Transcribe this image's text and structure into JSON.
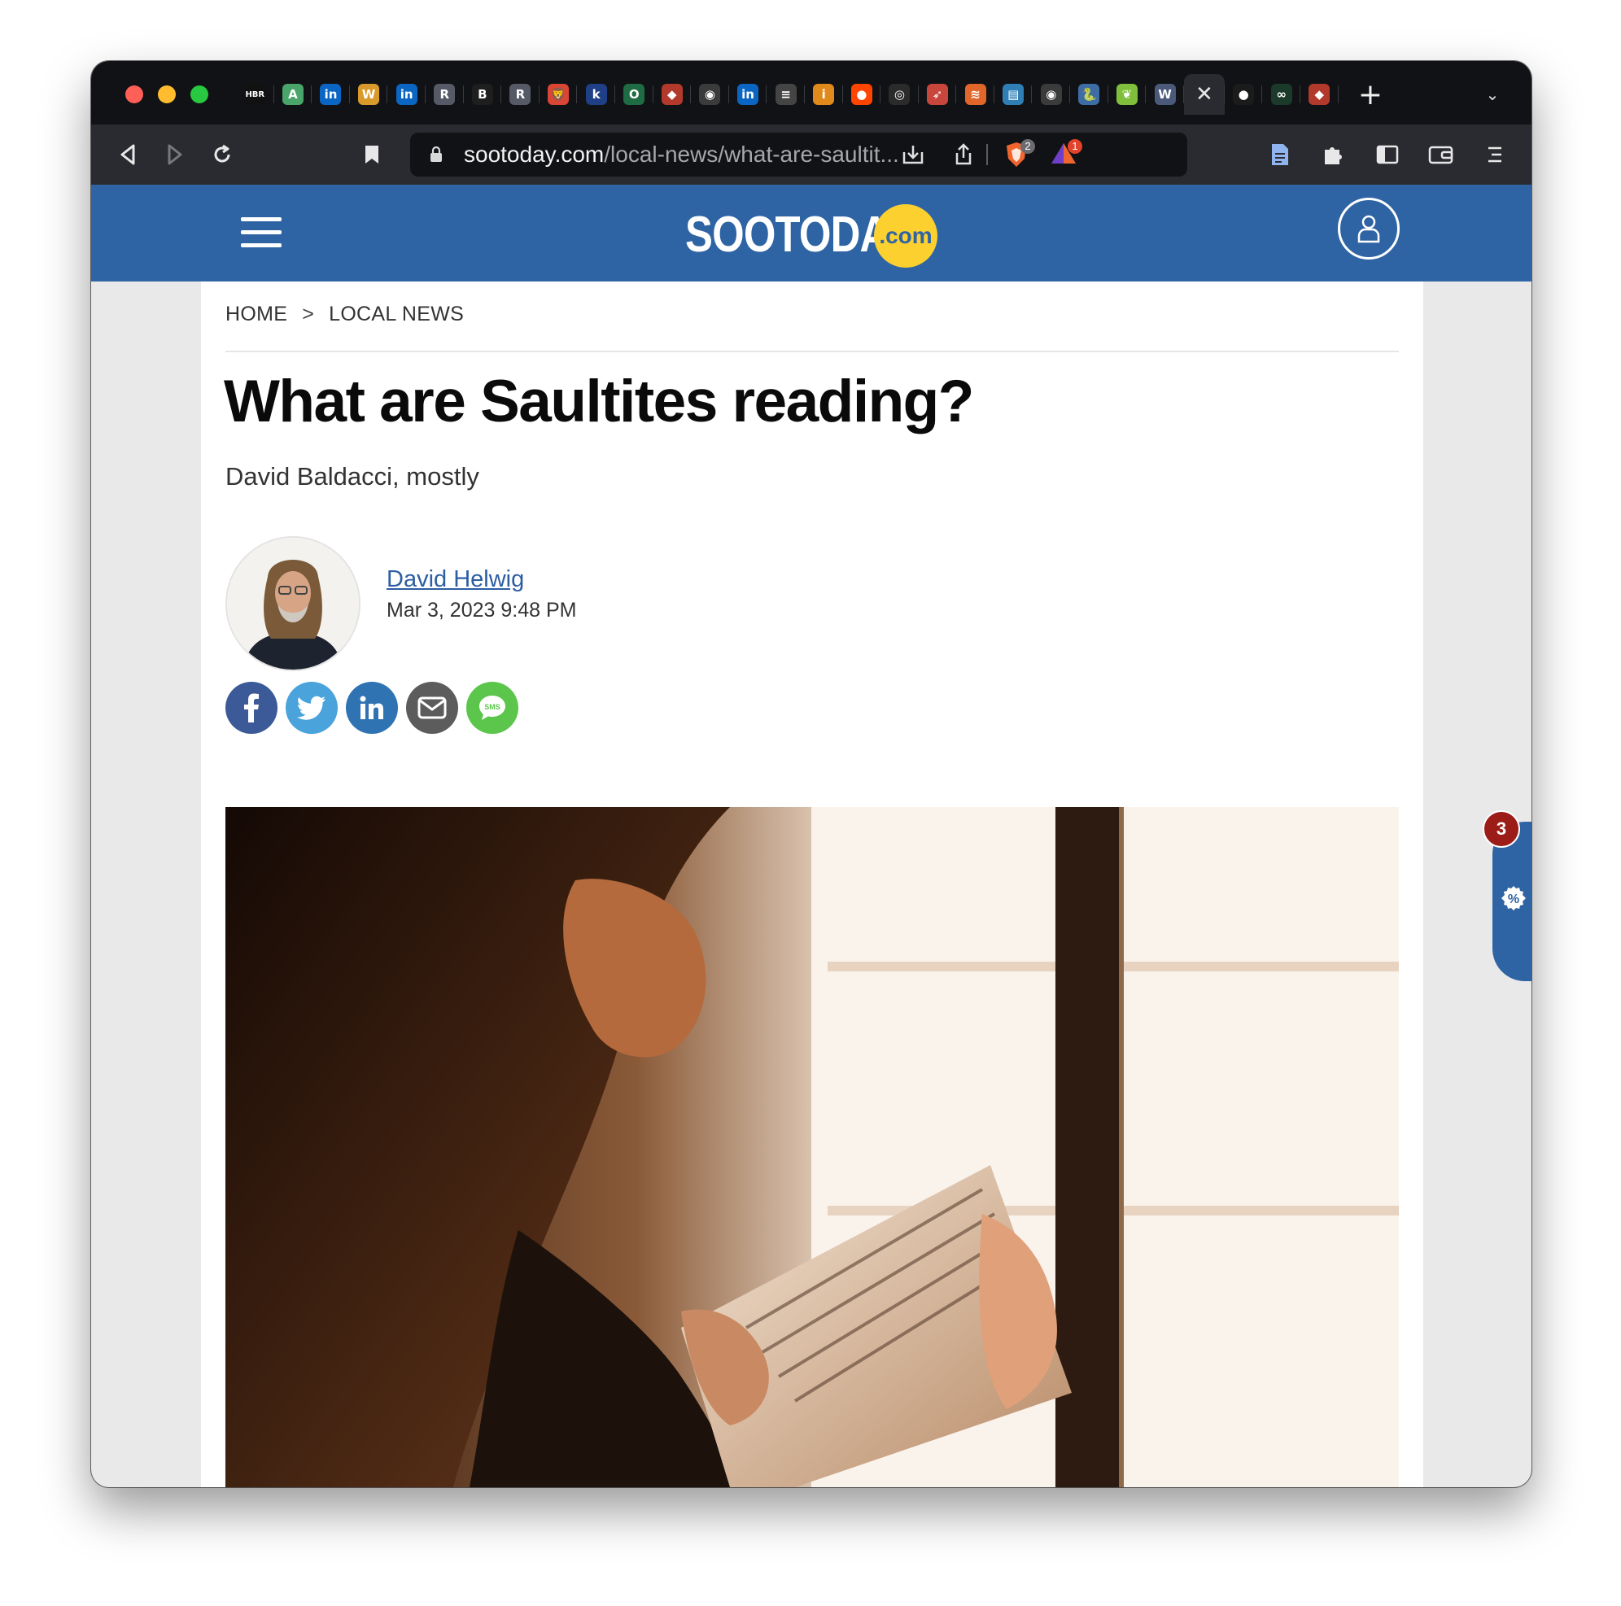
{
  "browser": {
    "tabs": [
      {
        "icon": "hbr-favicon",
        "glyph": "HBR",
        "color": "#111111"
      },
      {
        "icon": "a-favicon",
        "glyph": "A",
        "color": "#4aa56a"
      },
      {
        "icon": "linkedin-favicon",
        "glyph": "in",
        "color": "#0a66c2"
      },
      {
        "icon": "w-favicon",
        "glyph": "W",
        "color": "#d99a2b"
      },
      {
        "icon": "linkedin-favicon",
        "glyph": "in",
        "color": "#0a66c2"
      },
      {
        "icon": "r-favicon",
        "glyph": "R",
        "color": "#555a66"
      },
      {
        "icon": "b-favicon",
        "glyph": "B",
        "color": "#1e1e1e"
      },
      {
        "icon": "r-favicon",
        "glyph": "R",
        "color": "#555a66"
      },
      {
        "icon": "lion-favicon",
        "glyph": "🦁",
        "color": "#d94636"
      },
      {
        "icon": "k-favicon",
        "glyph": "k",
        "color": "#1f3f86"
      },
      {
        "icon": "o-favicon",
        "glyph": "O",
        "color": "#1f6b44"
      },
      {
        "icon": "shield-favicon",
        "glyph": "◆",
        "color": "#b23a2c"
      },
      {
        "icon": "globe-favicon",
        "glyph": "◉",
        "color": "#3b3b3b"
      },
      {
        "icon": "linkedin-favicon",
        "glyph": "in",
        "color": "#0a66c2"
      },
      {
        "icon": "document-favicon",
        "glyph": "≡",
        "color": "#444444"
      },
      {
        "icon": "info-favicon",
        "glyph": "i",
        "color": "#e08a1b"
      },
      {
        "icon": "reddit-favicon",
        "glyph": "●",
        "color": "#ff4500"
      },
      {
        "icon": "github-favicon",
        "glyph": "◎",
        "color": "#2b2b2b"
      },
      {
        "icon": "rocket-favicon",
        "glyph": "➶",
        "color": "#c9463d"
      },
      {
        "icon": "stack-favicon",
        "glyph": "≋",
        "color": "#e0662a"
      },
      {
        "icon": "book-favicon",
        "glyph": "▤",
        "color": "#2f7fb6"
      },
      {
        "icon": "globe-favicon",
        "glyph": "◉",
        "color": "#3b3b3b"
      },
      {
        "icon": "python-favicon",
        "glyph": "🐍",
        "color": "#3d6da4"
      },
      {
        "icon": "leaf-favicon",
        "glyph": "❦",
        "color": "#7fbf3b"
      },
      {
        "icon": "w-favicon",
        "glyph": "W",
        "color": "#4b5a7a"
      },
      {
        "icon": "close-tab-icon",
        "glyph": "✕",
        "color": "#2a2b30",
        "active": true
      },
      {
        "icon": "dot-favicon",
        "glyph": "●",
        "color": "#1b1b1b"
      },
      {
        "icon": "link-favicon",
        "glyph": "∞",
        "color": "#1b3a2a"
      },
      {
        "icon": "shield-favicon",
        "glyph": "◆",
        "color": "#b23a2c"
      }
    ],
    "url_host": "sootoday.com",
    "url_path": "/local-news/what-are-saultit...",
    "shield_count": "2",
    "rewards_count": "1"
  },
  "site": {
    "logo_text": "SOOTODAY",
    "logo_suffix": ".com"
  },
  "article": {
    "breadcrumb": [
      "HOME",
      "LOCAL NEWS"
    ],
    "breadcrumb_sep": ">",
    "title": "What are Saultites reading?",
    "subtitle": "David Baldacci, mostly",
    "author": "David Helwig",
    "date": "Mar 3, 2023 9:48 PM",
    "share_buttons": [
      {
        "name": "facebook-share-button",
        "icon": "facebook-icon",
        "color": "#3b5a97"
      },
      {
        "name": "twitter-share-button",
        "icon": "twitter-icon",
        "color": "#4ba3dc"
      },
      {
        "name": "linkedin-share-button",
        "icon": "linkedin-icon",
        "color": "#2f73b3"
      },
      {
        "name": "email-share-button",
        "icon": "email-icon",
        "color": "#5c5c5c"
      },
      {
        "name": "sms-share-button",
        "icon": "sms-icon",
        "color": "#5bc64b"
      }
    ]
  },
  "floating_widget": {
    "badge_count": "3",
    "icon": "discount-icon"
  },
  "colors": {
    "brand_blue": "#2f64a4",
    "logo_yellow": "#fcd02f",
    "link_blue": "#2c5ea3",
    "badge_red": "#9c1c17"
  }
}
